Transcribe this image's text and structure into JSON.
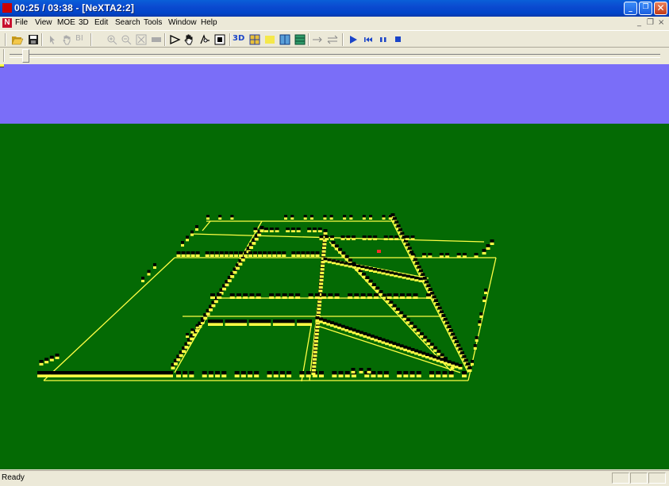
{
  "window": {
    "title": "00:25 / 03:38 - [NeXTA2:2]"
  },
  "menubar": {
    "items": [
      "File",
      "View",
      "MOE",
      "3D",
      "Edit",
      "Search",
      "Tools",
      "Window",
      "Help"
    ],
    "mdi_controls": [
      "_",
      "❐",
      "×"
    ]
  },
  "toolbar": {
    "3d_label": "3D",
    "bi_label": "BI"
  },
  "playback": {
    "slider_fraction": 0.02
  },
  "colors": {
    "sky": "#7a6ef8",
    "ground": "#046a04",
    "road": "#ffff44",
    "vehicle": "#000000",
    "highlight": "#ff2a2a"
  },
  "statusbar": {
    "text": "Ready"
  }
}
